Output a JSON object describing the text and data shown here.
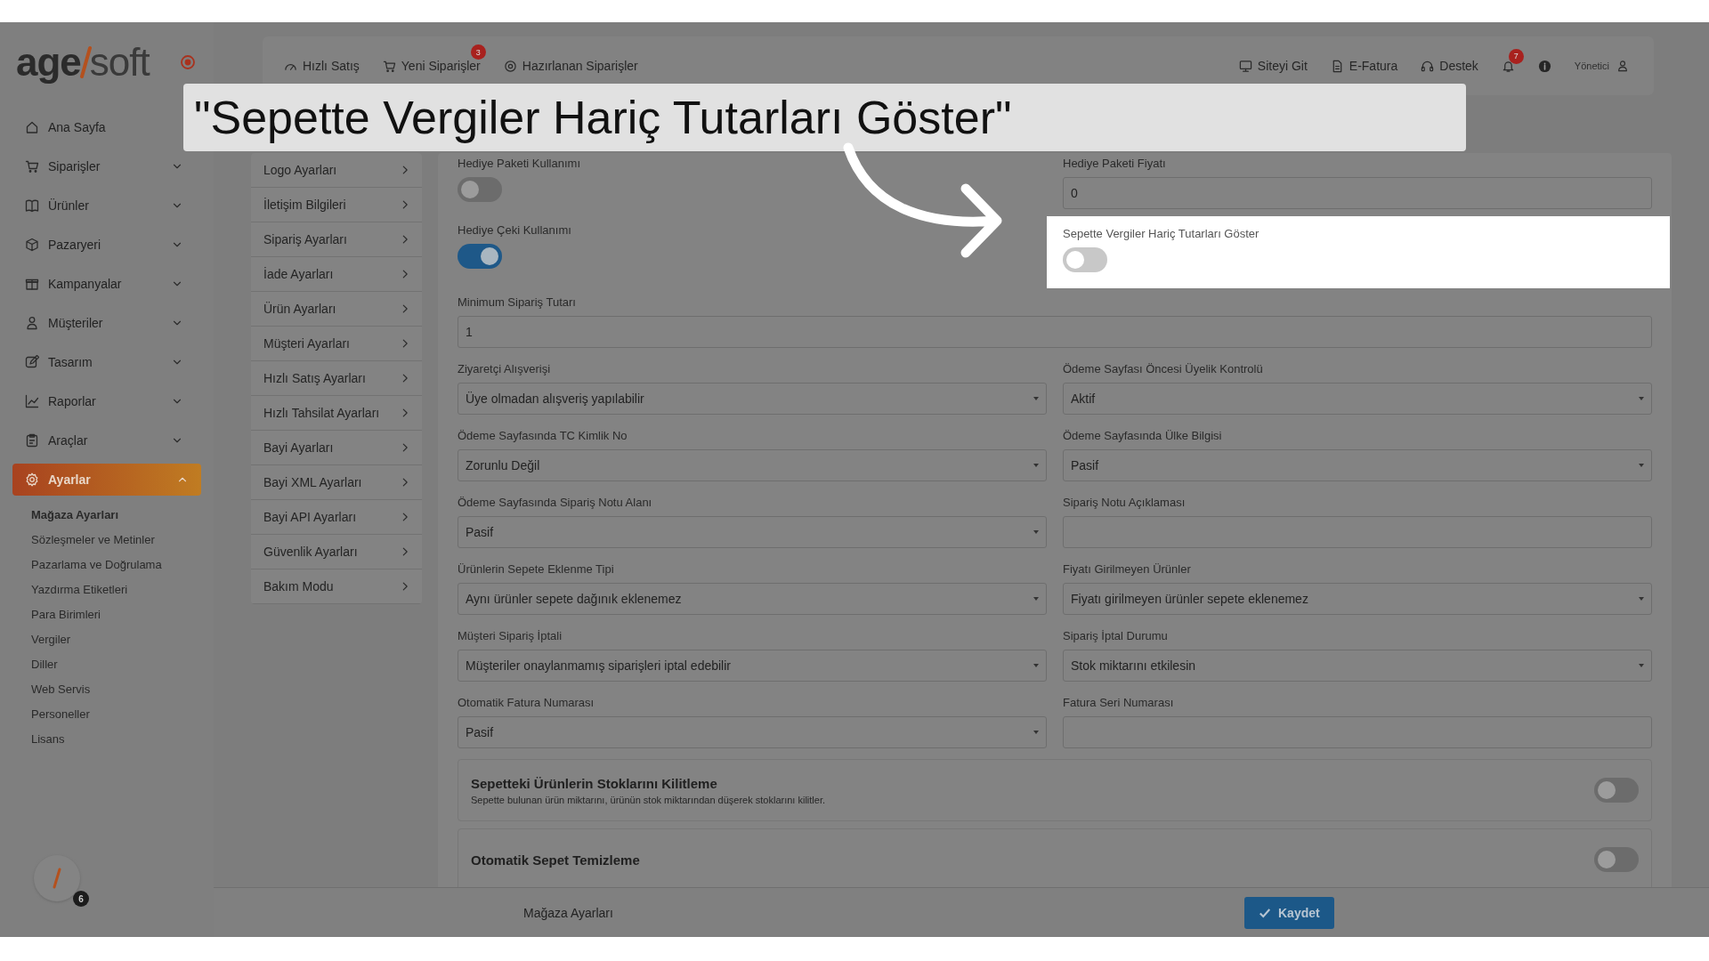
{
  "logo": {
    "left": "age",
    "right": "soft"
  },
  "top_nav": [
    {
      "label": "Hızlı Satış"
    },
    {
      "label": "Yeni Siparişler",
      "badge": "3"
    },
    {
      "label": "Hazırlanan Siparişler"
    }
  ],
  "top_right": [
    {
      "label": "Siteyi Git"
    },
    {
      "label": "E-Fatura"
    },
    {
      "label": "Destek"
    }
  ],
  "notifications": {
    "badge": "7"
  },
  "user": {
    "label": "Yönetici"
  },
  "sidebar": {
    "items": [
      {
        "label": "Ana Sayfa",
        "selected": false
      },
      {
        "label": "Siparişler",
        "expanded": false,
        "selected": false
      },
      {
        "label": "Ürünler",
        "expanded": false,
        "selected": false
      },
      {
        "label": "Pazaryeri",
        "expanded": false,
        "selected": false
      },
      {
        "label": "Kampanyalar",
        "expanded": false,
        "selected": false
      },
      {
        "label": "Müşteriler",
        "expanded": false,
        "selected": false
      },
      {
        "label": "Tasarım",
        "expanded": false,
        "selected": false
      },
      {
        "label": "Raporlar",
        "expanded": false,
        "selected": false
      },
      {
        "label": "Araçlar",
        "expanded": false,
        "selected": false
      },
      {
        "label": "Ayarlar",
        "expanded": true,
        "selected": true,
        "children": [
          {
            "label": "Mağaza Ayarları",
            "selected": true
          },
          {
            "label": "Sözleşmeler ve Metinler",
            "selected": false
          },
          {
            "label": "Pazarlama ve Doğrulama",
            "selected": false
          },
          {
            "label": "Yazdırma Etiketleri",
            "selected": false
          },
          {
            "label": "Para Birimleri",
            "selected": false
          },
          {
            "label": "Vergiler",
            "selected": false
          },
          {
            "label": "Diller",
            "selected": false
          },
          {
            "label": "Web Servis",
            "selected": false
          },
          {
            "label": "Personeller",
            "selected": false
          },
          {
            "label": "Lisans",
            "selected": false
          }
        ]
      }
    ],
    "avatar_badge": "6"
  },
  "settings_menu": [
    {
      "label": "Logo Ayarları",
      "selected": false
    },
    {
      "label": "İletişim Bilgileri",
      "selected": false
    },
    {
      "label": "Sipariş Ayarları",
      "selected": false
    },
    {
      "label": "İade Ayarları",
      "selected": false
    },
    {
      "label": "Ürün Ayarları",
      "selected": false
    },
    {
      "label": "Müşteri Ayarları",
      "selected": false
    },
    {
      "label": "Hızlı Satış Ayarları",
      "selected": false
    },
    {
      "label": "Hızlı Tahsilat Ayarları",
      "selected": false
    },
    {
      "label": "Bayi Ayarları",
      "selected": false
    },
    {
      "label": "Bayi XML Ayarları",
      "selected": false
    },
    {
      "label": "Bayi API Ayarları",
      "selected": false
    },
    {
      "label": "Güvenlik Ayarları",
      "selected": false
    },
    {
      "label": "Bakım Modu",
      "selected": false
    }
  ],
  "fields": [
    {
      "kind": "toggle",
      "label": "Hediye Paketi Kullanımı",
      "on": false,
      "highlighted": false
    },
    {
      "kind": "input",
      "label": "Hediye Paketi Fiyatı",
      "value": "0",
      "highlighted": false
    },
    {
      "kind": "toggle",
      "label": "Hediye Çeki Kullanımı",
      "on": true,
      "highlighted": false
    },
    {
      "kind": "toggle",
      "label": "Sepette Vergiler Hariç Tutarları Göster",
      "on": false,
      "highlighted": true
    },
    {
      "kind": "input",
      "label": "Minimum Sipariş Tutarı",
      "value": "1",
      "wide": true,
      "highlighted": false
    },
    {
      "kind": "select",
      "label": "Ziyaretçi Alışverişi",
      "value": "Üye olmadan alışveriş yapılabilir",
      "highlighted": false
    },
    {
      "kind": "select",
      "label": "Ödeme Sayfası Öncesi Üyelik Kontrolü",
      "value": "Aktif",
      "highlighted": false
    },
    {
      "kind": "select",
      "label": "Ödeme Sayfasında TC Kimlik No",
      "value": "Zorunlu Değil",
      "highlighted": false
    },
    {
      "kind": "select",
      "label": "Ödeme Sayfasında Ülke Bilgisi",
      "value": "Pasif",
      "highlighted": false
    },
    {
      "kind": "select",
      "label": "Ödeme Sayfasında Sipariş Notu Alanı",
      "value": "Pasif",
      "highlighted": false
    },
    {
      "kind": "input",
      "label": "Sipariş Notu Açıklaması",
      "highlighted": false
    },
    {
      "kind": "select",
      "label": "Ürünlerin Sepete Eklenme Tipi",
      "value": "Aynı ürünler sepete dağınık eklenemez",
      "highlighted": false
    },
    {
      "kind": "select",
      "label": "Fiyatı Girilmeyen Ürünler",
      "value": "Fiyatı girilmeyen ürünler sepete eklenemez",
      "highlighted": false
    },
    {
      "kind": "select",
      "label": "Müşteri Sipariş İptali",
      "value": "Müşteriler onaylanmamış siparişleri iptal edebilir",
      "highlighted": false
    },
    {
      "kind": "select",
      "label": "Sipariş İptal Durumu",
      "value": "Stok miktarını etkilesin",
      "highlighted": false
    },
    {
      "kind": "select",
      "label": "Otomatik Fatura Numarası",
      "value": "Pasif",
      "highlighted": false
    },
    {
      "kind": "input",
      "label": "Fatura Seri Numarası",
      "highlighted": false
    },
    {
      "kind": "switch_card",
      "label": "Sepetteki Ürünlerin Stoklarını Kilitleme",
      "description": "Sepette bulunan ürün miktarını, ürünün stok miktarından düşerek stoklarını kilitler.",
      "on": false,
      "wide": true,
      "highlighted": false
    },
    {
      "kind": "switch_card",
      "label": "Otomatik Sepet Temizleme",
      "on": false,
      "wide": true,
      "highlighted": false
    }
  ],
  "footer": {
    "label": "Mağaza Ayarları",
    "save": "Kaydet"
  },
  "callout": {
    "text": "\"Sepette Vergiler Hariç Tutarları Göster\""
  }
}
